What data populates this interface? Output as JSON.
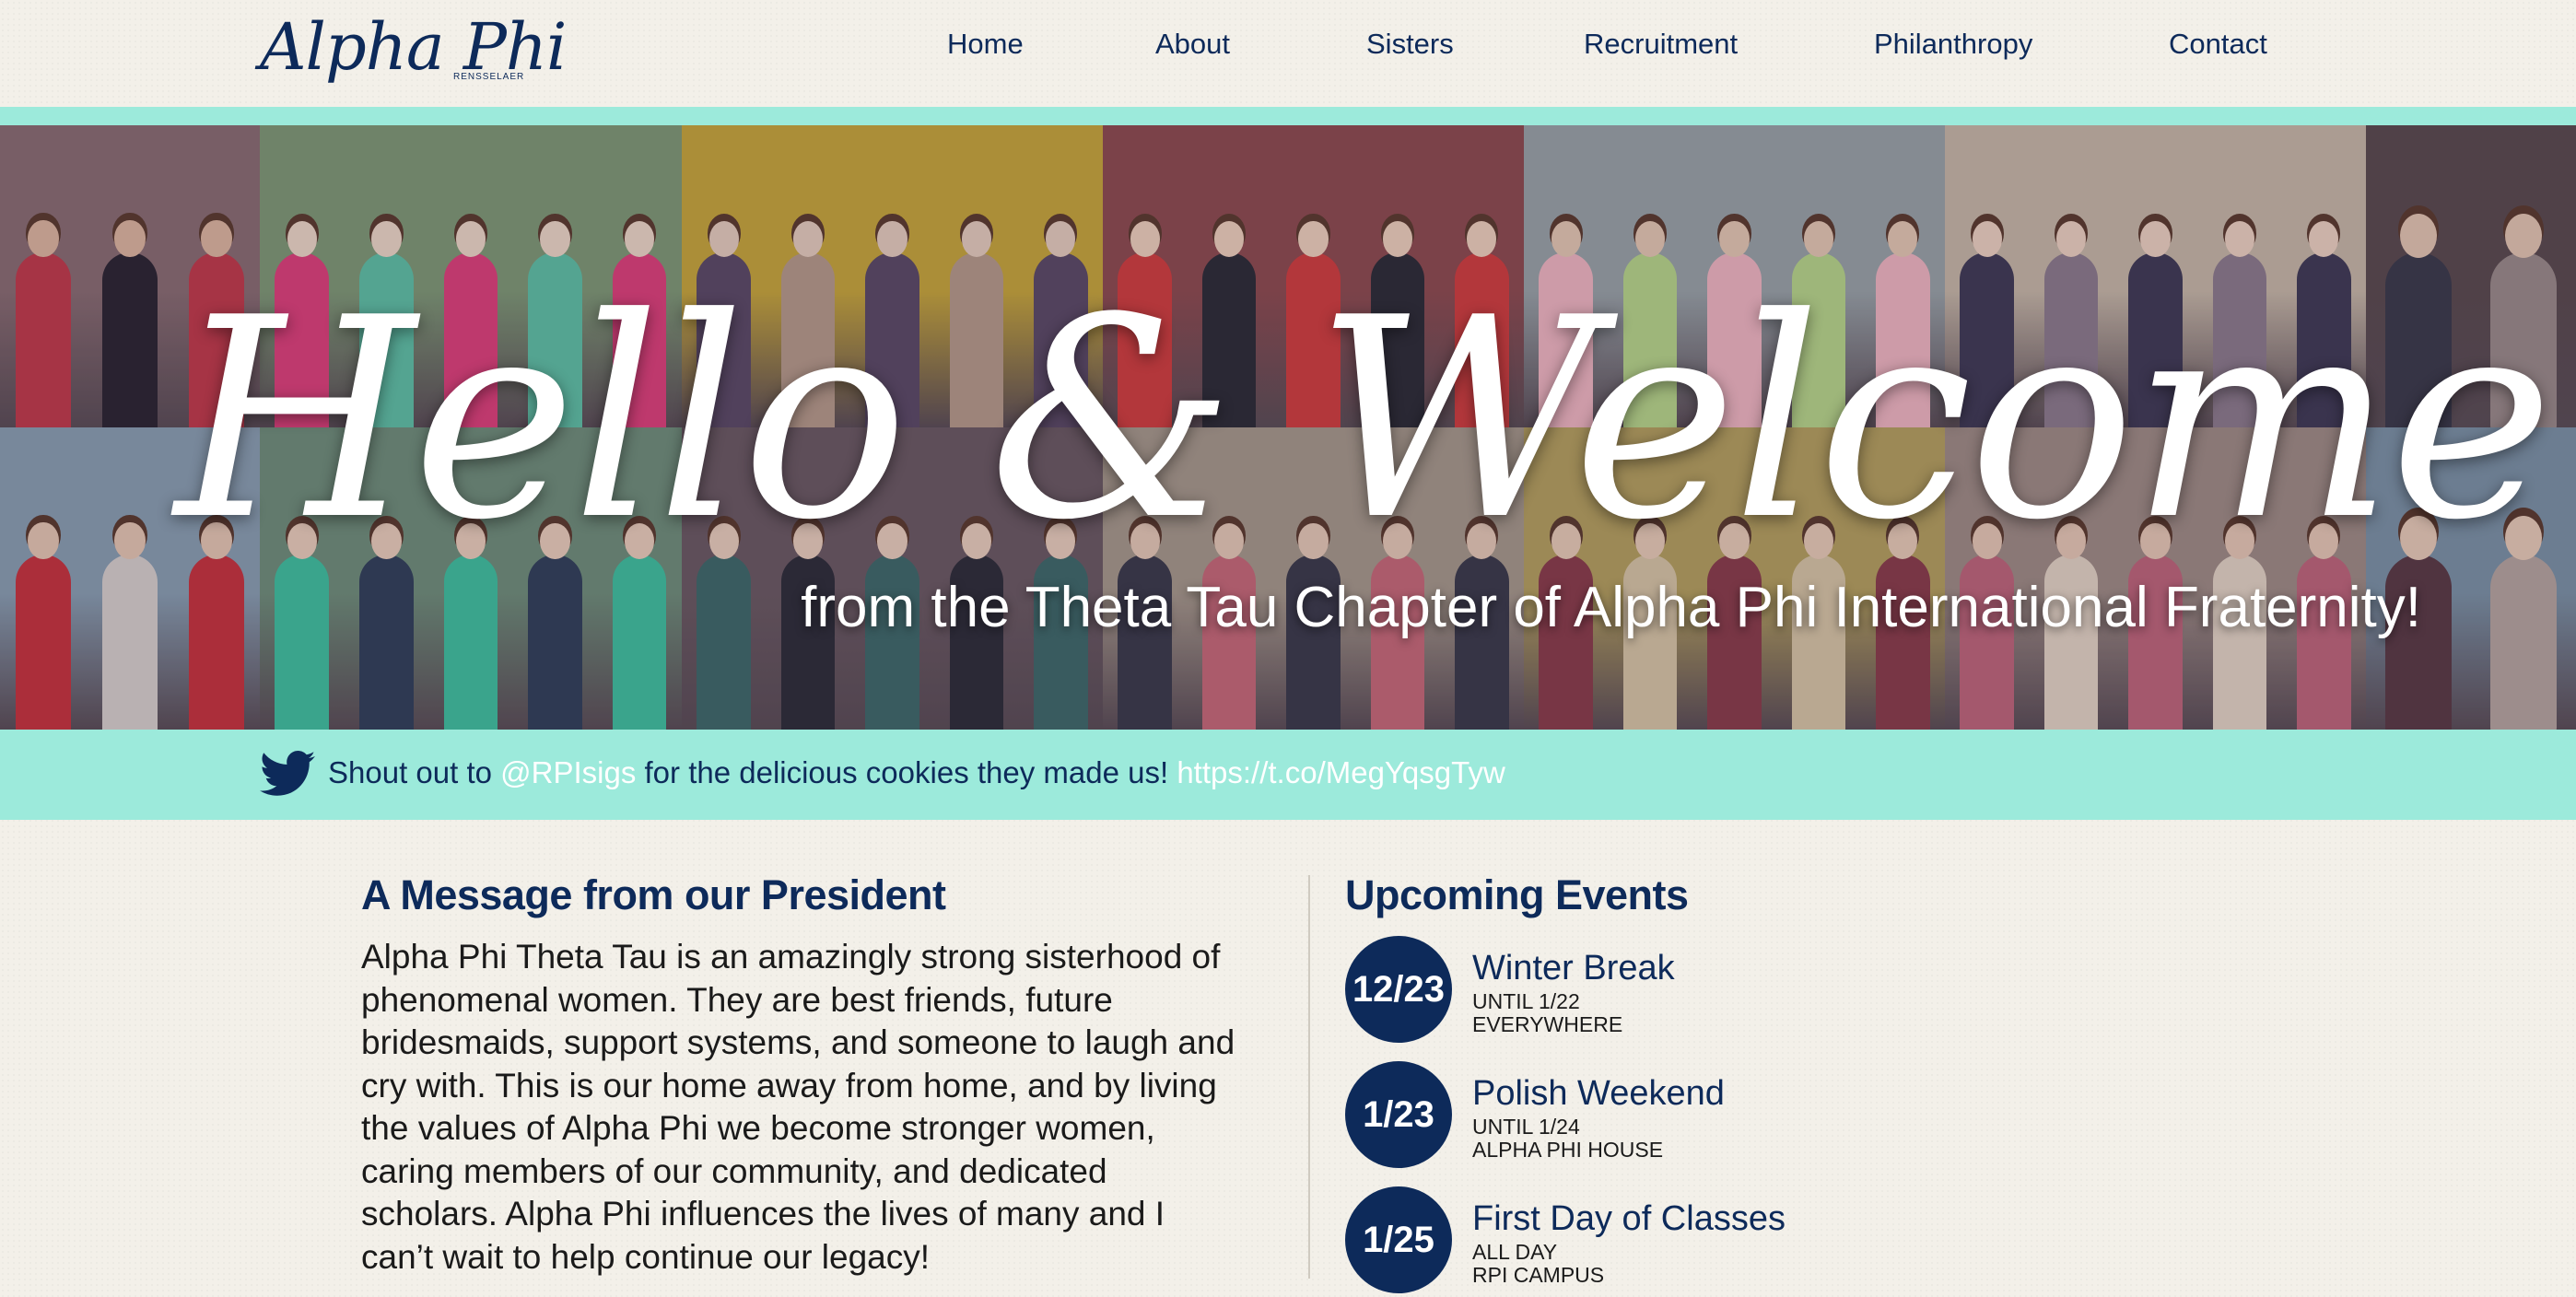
{
  "logo": {
    "script": "Alpha Phi",
    "sub": "RENSSELAER"
  },
  "nav": [
    "Home",
    "About",
    "Sisters",
    "Recruitment",
    "Philanthropy",
    "Contact"
  ],
  "hero": {
    "title": "Hello & Welcome",
    "subtitle": "from the Theta Tau Chapter of Alpha Phi International Fraternity!"
  },
  "tweet": {
    "icon": "twitter-bird-icon",
    "prefix": "Shout out to ",
    "mention": "@RPIsigs",
    "middle": " for the delicious cookies they made us! ",
    "link": "https://t.co/MegYqsgTyw"
  },
  "president": {
    "title": "A Message from our President",
    "body": "Alpha Phi Theta Tau is an amazingly strong sisterhood of phenomenal women. They are best friends, future bridesmaids, support systems, and someone to laugh and cry with. This is our home away from home, and by living the values of Alpha Phi we become stronger women, caring members of our community, and dedicated scholars. Alpha Phi influences the lives of many and I can’t wait to help continue our legacy!"
  },
  "events": {
    "title": "Upcoming Events",
    "items": [
      {
        "date": "12/23",
        "name": "Winter Break",
        "when": "UNTIL 1/22",
        "where": "EVERYWHERE"
      },
      {
        "date": "1/23",
        "name": "Polish Weekend",
        "when": "UNTIL 1/24",
        "where": "ALPHA PHI HOUSE"
      },
      {
        "date": "1/25",
        "name": "First Day of Classes",
        "when": "ALL DAY",
        "where": "RPI CAMPUS"
      }
    ]
  },
  "colors": {
    "navy": "#0d2a5a",
    "mint": "#9ceadb",
    "background": "#f3f0e9"
  }
}
